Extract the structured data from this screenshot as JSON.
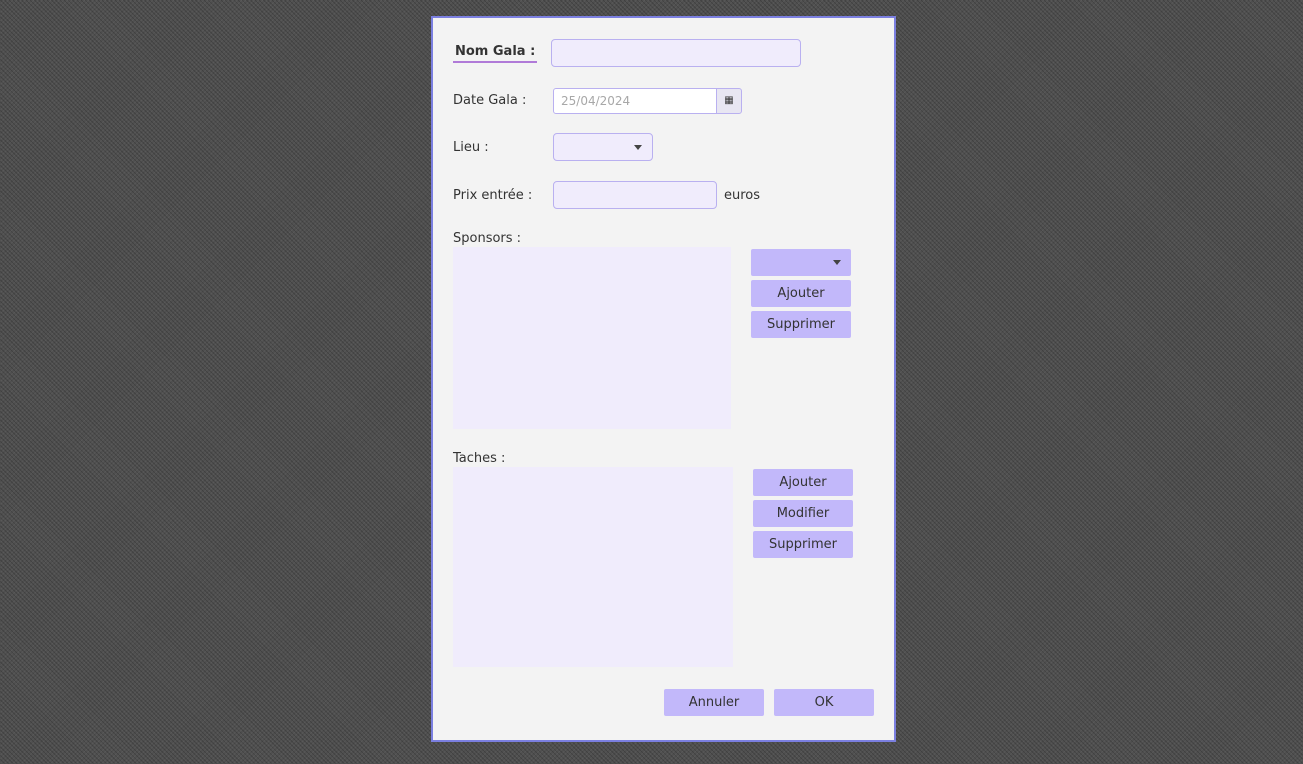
{
  "form": {
    "nom_gala": {
      "label": "Nom Gala :",
      "value": ""
    },
    "date_gala": {
      "label": "Date Gala :",
      "placeholder": "25/04/2024",
      "calendar_icon": "calendar-icon"
    },
    "lieu": {
      "label": "Lieu :",
      "selected": ""
    },
    "prix_entree": {
      "label": "Prix entrée :",
      "value": "",
      "unit": "euros"
    }
  },
  "sponsors": {
    "label": "Sponsors :",
    "selected": "",
    "buttons": {
      "add": "Ajouter",
      "remove": "Supprimer"
    }
  },
  "taches": {
    "label": "Taches :",
    "buttons": {
      "add": "Ajouter",
      "edit": "Modifier",
      "remove": "Supprimer"
    }
  },
  "footer": {
    "cancel": "Annuler",
    "ok": "OK"
  },
  "colors": {
    "dialog_border": "#7b7fe0",
    "button_bg": "#c2b8fa",
    "field_bg": "#f0ecfc",
    "dialog_bg": "#f3f3f3"
  }
}
